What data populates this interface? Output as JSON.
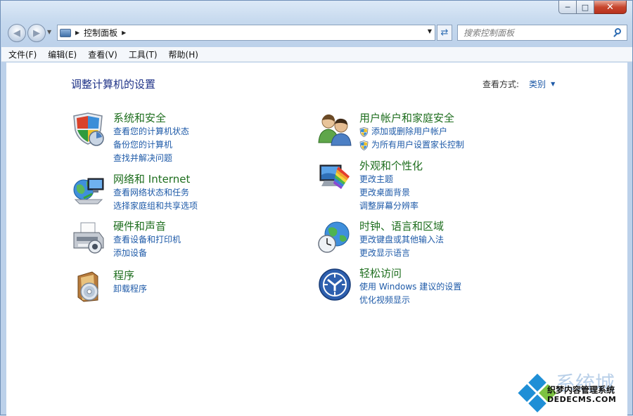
{
  "colors": {
    "title_link": "#1e6e1e",
    "task_link": "#1e5aa8",
    "heading": "#1e3287",
    "close_button": "#c7462e"
  },
  "caption": {
    "minimize_icon": "minimize-icon",
    "maximize_icon": "maximize-icon",
    "close_icon": "close-icon"
  },
  "nav": {
    "address_path": "控制面板",
    "search_placeholder": "搜索控制面板"
  },
  "menu": {
    "file": "文件(F)",
    "edit": "编辑(E)",
    "view": "查看(V)",
    "tools": "工具(T)",
    "help": "帮助(H)"
  },
  "page": {
    "title": "调整计算机的设置",
    "view_by_label": "查看方式:",
    "view_by_value": "类别"
  },
  "categories": [
    {
      "title": "系统和安全",
      "icon": "shield-icon",
      "links": [
        "查看您的计算机状态",
        "备份您的计算机",
        "查找并解决问题"
      ]
    },
    {
      "title": "网络和 Internet",
      "icon": "network-icon",
      "links": [
        "查看网络状态和任务",
        "选择家庭组和共享选项"
      ]
    },
    {
      "title": "硬件和声音",
      "icon": "printer-icon",
      "links": [
        "查看设备和打印机",
        "添加设备"
      ]
    },
    {
      "title": "程序",
      "icon": "programs-icon",
      "links": [
        "卸载程序"
      ]
    },
    {
      "title": "用户帐户和家庭安全",
      "icon": "users-icon",
      "links": [
        "添加或删除用户帐户",
        "为所有用户设置家长控制"
      ]
    },
    {
      "title": "外观和个性化",
      "icon": "appearance-icon",
      "links": [
        "更改主题",
        "更改桌面背景",
        "调整屏幕分辨率"
      ]
    },
    {
      "title": "时钟、语言和区域",
      "icon": "clock-globe-icon",
      "links": [
        "更改键盘或其他输入法",
        "更改显示语言"
      ]
    },
    {
      "title": "轻松访问",
      "icon": "ease-of-access-icon",
      "links": [
        "使用 Windows 建议的设置",
        "优化视频显示"
      ]
    }
  ],
  "watermark": {
    "line1": "织梦内容管理系统",
    "line2": "DEDECMS.COM",
    "brand": "系统城"
  }
}
